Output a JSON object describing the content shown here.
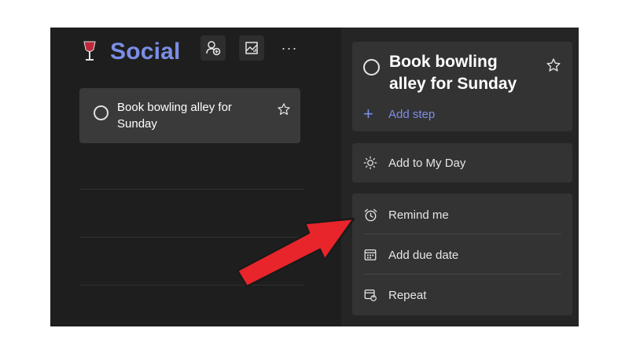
{
  "list": {
    "icon": "wine-glass-icon",
    "title": "Social"
  },
  "toolbar": {
    "share_icon": "person-add-icon",
    "background_icon": "image-icon",
    "more_label": "···"
  },
  "tasks": [
    {
      "title": "Book bowling alley for Sunday",
      "starred": false
    }
  ],
  "detail": {
    "title": "Book bowling alley for Sunday",
    "add_step_label": "Add step",
    "add_to_my_day_label": "Add to My Day",
    "remind_me_label": "Remind me",
    "add_due_date_label": "Add due date",
    "repeat_label": "Repeat"
  },
  "colors": {
    "accent": "#7b8ee6",
    "arrow": "#e8252b"
  }
}
